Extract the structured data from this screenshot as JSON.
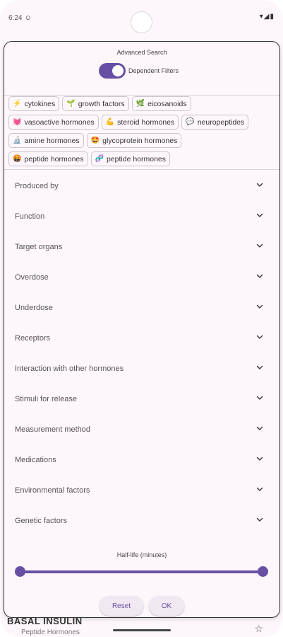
{
  "status_bar": {
    "time": "6:24",
    "small_icon": "⊙",
    "right_icons": "▾◢▮"
  },
  "background": {
    "title": "BASAL INSULIN",
    "subtitle": "Peptide Hormones"
  },
  "sheet": {
    "title": "Advanced Search",
    "toggle_label": "Dependent Filters",
    "toggle_on": true,
    "chip_rows": [
      [
        {
          "emoji": "⚡",
          "label": "cytokines"
        },
        {
          "emoji": "🌱",
          "label": "growth factors"
        },
        {
          "emoji": "🌿",
          "label": "eicosanoids"
        }
      ],
      [
        {
          "emoji": "💓",
          "label": "vasoactive hormones"
        },
        {
          "emoji": "💪",
          "label": "steroid hormones"
        },
        {
          "emoji": "💬",
          "label": "neuropeptides"
        }
      ],
      [
        {
          "emoji": "🔬",
          "label": "amine hormones"
        },
        {
          "emoji": "🤩",
          "label": "glycoprotein hormones"
        }
      ],
      [
        {
          "emoji": "🤬",
          "label": "peptide hormones"
        },
        {
          "emoji": "🧬",
          "label": "peptide hormones"
        }
      ]
    ],
    "filters": [
      "Produced by",
      "Function",
      "Target organs",
      "Overdose",
      "Underdose",
      "Receptors",
      "Interaction with other hormones",
      "Stimuli for release",
      "Measurement method",
      "Medications",
      "Environmental factors",
      "Genetic factors"
    ],
    "slider": {
      "label": "Half-life (minutes)",
      "range_fraction": [
        0,
        1
      ]
    },
    "reset_label": "Reset",
    "ok_label": "OK"
  },
  "accent_color": "#6750a4"
}
